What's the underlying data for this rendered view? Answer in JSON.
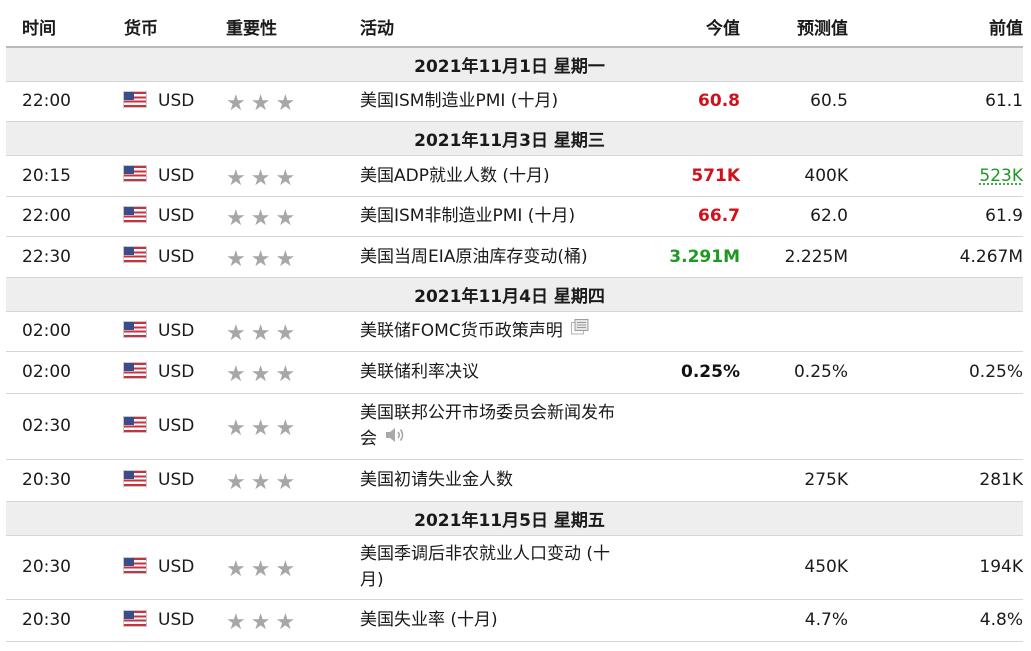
{
  "headers": {
    "time": "时间",
    "currency": "货币",
    "importance": "重要性",
    "event": "活动",
    "actual": "今值",
    "forecast": "预测值",
    "previous": "前值"
  },
  "colors": {
    "up": "#d0101b",
    "down": "#1c9a22",
    "star": "#a7a7a7",
    "date_row_bg": "#eeeeee"
  },
  "days": [
    {
      "date": "2021年11月1日  星期一",
      "events": [
        {
          "time": "22:00",
          "currency": "USD",
          "flag_icon": "us-flag-icon",
          "importance": 3,
          "event": "美国ISM制造业PMI (十月)",
          "actual": "60.8",
          "actual_trend": "up",
          "forecast": "60.5",
          "previous": "61.1",
          "previous_trend": "neutral"
        }
      ]
    },
    {
      "date": "2021年11月3日  星期三",
      "events": [
        {
          "time": "20:15",
          "currency": "USD",
          "flag_icon": "us-flag-icon",
          "importance": 3,
          "event": "美国ADP就业人数 (十月)",
          "actual": "571K",
          "actual_trend": "up",
          "forecast": "400K",
          "previous": "523K",
          "previous_trend": "revised-up"
        },
        {
          "time": "22:00",
          "currency": "USD",
          "flag_icon": "us-flag-icon",
          "importance": 3,
          "event": "美国ISM非制造业PMI (十月)",
          "actual": "66.7",
          "actual_trend": "up",
          "forecast": "62.0",
          "previous": "61.9",
          "previous_trend": "neutral"
        },
        {
          "time": "22:30",
          "currency": "USD",
          "flag_icon": "us-flag-icon",
          "importance": 3,
          "event": "美国当周EIA原油库存变动(桶)",
          "actual": "3.291M",
          "actual_trend": "down",
          "forecast": "2.225M",
          "previous": "4.267M",
          "previous_trend": "neutral"
        }
      ]
    },
    {
      "date": "2021年11月4日  星期四",
      "events": [
        {
          "time": "02:00",
          "currency": "USD",
          "flag_icon": "us-flag-icon",
          "importance": 3,
          "event": "美联储FOMC货币政策声明",
          "event_icon": "document-icon",
          "actual": "",
          "actual_trend": "neutral",
          "forecast": "",
          "previous": "",
          "previous_trend": "neutral"
        },
        {
          "time": "02:00",
          "currency": "USD",
          "flag_icon": "us-flag-icon",
          "importance": 3,
          "event": "美联储利率决议",
          "actual": "0.25%",
          "actual_trend": "neutral",
          "forecast": "0.25%",
          "previous": "0.25%",
          "previous_trend": "neutral"
        },
        {
          "time": "02:30",
          "currency": "USD",
          "flag_icon": "us-flag-icon",
          "importance": 3,
          "event": "美国联邦公开市场委员会新闻发布会",
          "event_icon": "speaker-icon",
          "actual": "",
          "actual_trend": "neutral",
          "forecast": "",
          "previous": "",
          "previous_trend": "neutral"
        },
        {
          "time": "20:30",
          "currency": "USD",
          "flag_icon": "us-flag-icon",
          "importance": 3,
          "event": "美国初请失业金人数",
          "actual": "",
          "actual_trend": "neutral",
          "forecast": "275K",
          "previous": "281K",
          "previous_trend": "neutral"
        }
      ]
    },
    {
      "date": "2021年11月5日  星期五",
      "events": [
        {
          "time": "20:30",
          "currency": "USD",
          "flag_icon": "us-flag-icon",
          "importance": 3,
          "event": "美国季调后非农就业人口变动 (十月)",
          "actual": "",
          "actual_trend": "neutral",
          "forecast": "450K",
          "previous": "194K",
          "previous_trend": "neutral"
        },
        {
          "time": "20:30",
          "currency": "USD",
          "flag_icon": "us-flag-icon",
          "importance": 3,
          "event": "美国失业率 (十月)",
          "actual": "",
          "actual_trend": "neutral",
          "forecast": "4.7%",
          "previous": "4.8%",
          "previous_trend": "neutral"
        }
      ]
    }
  ]
}
